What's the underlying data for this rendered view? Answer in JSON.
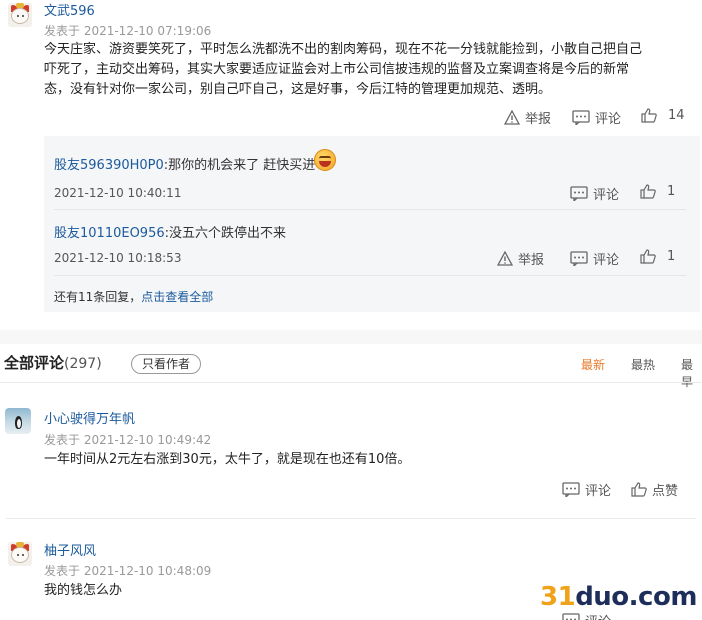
{
  "comment1": {
    "user": "文武596",
    "time": "发表于 2021-12-10 07:19:06",
    "lines": [
      "今天庄家、游资要笑死了，平时怎么洗都洗不出的割肉筹码，现在不花一分钱就能捡到，小散自己把自己",
      "吓死了，主动交出筹码，其实大家要适应证监会对上市公司信披违规的监督及立案调查将是今后的新常",
      "态，没有针对你一家公司，别自己吓自己，这是好事，今后江特的管理更加规范、透明。"
    ],
    "report_label": "举报",
    "comment_label": "评论",
    "likes": "14"
  },
  "replies": [
    {
      "user": "股友596390H0P0",
      "text": ":那你的机会来了 赶快买进",
      "time": "2021-12-10 10:40:11",
      "comment_label": "评论",
      "likes": "1"
    },
    {
      "user": "股友10110EO956",
      "text": ":没五六个跌停出不来",
      "time": "2021-12-10 10:18:53",
      "report_label": "举报",
      "comment_label": "评论",
      "likes": "1"
    }
  ],
  "more_replies": {
    "count_text": "还有11条回复，",
    "link_text": "点击查看全部"
  },
  "all_comments": {
    "title": "全部评论",
    "count": "(297)",
    "filter_label": "只看作者",
    "sort_options": [
      "最新",
      "最热",
      "最早"
    ],
    "active_sort": "最新"
  },
  "comment2": {
    "user": "小心驶得万年帆",
    "time": "发表于 2021-12-10 10:49:42",
    "text": "一年时间从2元左右涨到30元，太牛了，就是现在也还有10倍。",
    "comment_label": "评论",
    "like_label": "点赞"
  },
  "comment3": {
    "user": "柚子风风",
    "time": "发表于 2021-12-10 10:48:09",
    "text": "我的钱怎么办",
    "comment_label": "评论"
  },
  "watermark": {
    "number": "31",
    "word": "duo.com"
  },
  "colors": {
    "link_blue": "#1b5a9c",
    "active_orange": "#e87a2b",
    "reply_bg": "#f5f6f8"
  }
}
